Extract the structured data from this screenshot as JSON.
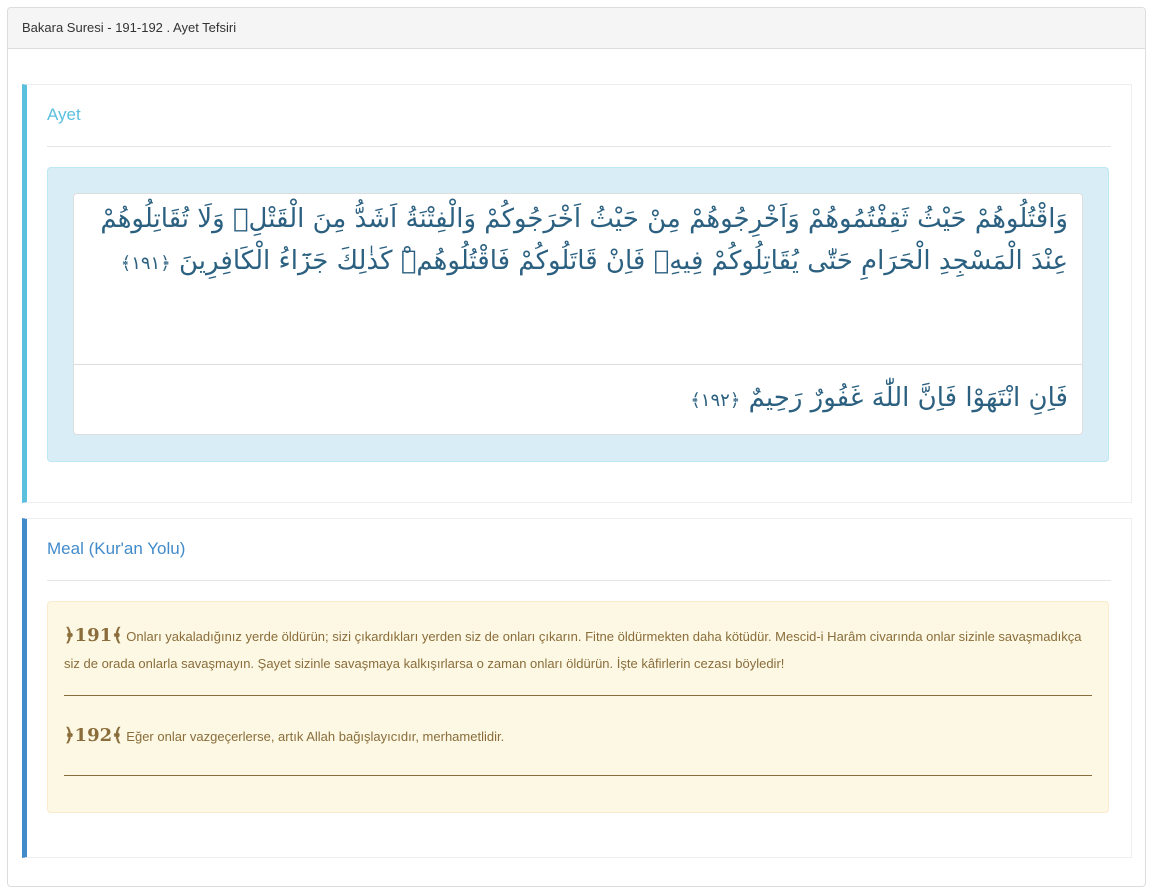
{
  "panel": {
    "title": "Bakara Suresi - 191-192 . Ayet Tefsiri"
  },
  "ayet_section": {
    "title": "Ayet",
    "verses": [
      {
        "text": "وَاقْتُلُوهُمْ حَيْثُ ثَقِفْتُمُوهُمْ وَاَخْرِجُوهُمْ مِنْ حَيْثُ اَخْرَجُوكُمْ وَالْفِتْنَةُ اَشَدُّ مِنَ الْقَتْلِۚ وَلَا تُقَاتِلُوهُمْ عِنْدَ الْمَسْجِدِ الْحَرَامِ حَتّٰى يُقَاتِلُوكُمْ فِيهِۚ فَاِنْ قَاتَلُوكُمْ فَاقْتُلُوهُمْۜ كَذٰلِكَ جَزَٓاءُ الْكَافِرِينَ",
        "number": "﴿١٩١﴾"
      },
      {
        "text": "فَاِنِ انْتَهَوْا فَاِنَّ اللّٰهَ غَفُورٌ رَحِيمٌ",
        "number": "﴿١٩٢﴾"
      }
    ]
  },
  "meal_section": {
    "title": "Meal (Kur'an Yolu)",
    "verses": [
      {
        "number": "﴿191﴾",
        "text": "Onları yakaladığınız yerde öldürün; sizi çıkardıkları yerden siz de onları çıkarın. Fitne öldürmekten daha kötüdür. Mescid-i Harâm civarında onlar sizinle savaşmadıkça siz de orada onlarla savaşmayın. Şayet sizinle savaşmaya kalkışırlarsa o zaman onları öldürün. İşte kâfirlerin cezası böyledir!"
      },
      {
        "number": "﴿192﴾",
        "text": "Eğer onlar vazgeçerlerse, artık Allah bağışlayıcıdır, merhametlidir."
      }
    ]
  },
  "colors": {
    "ayet_accent": "#5bc0de",
    "meal_accent": "#428bca",
    "arabic_text": "#2b6080",
    "meal_text": "#8a6d3b",
    "ayet_background": "#d9edf7",
    "meal_background": "#fcf8e3"
  }
}
